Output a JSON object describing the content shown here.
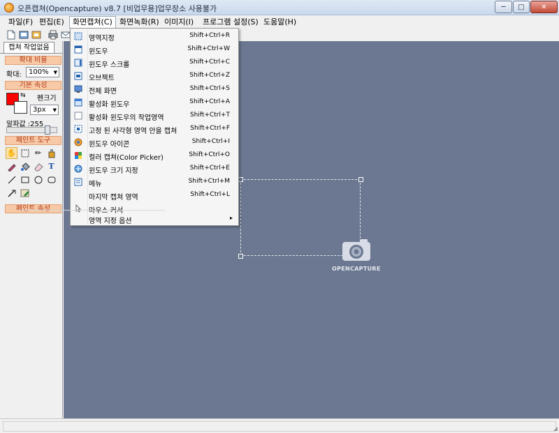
{
  "window": {
    "title": "오픈캡쳐(Opencapture) v8.7 [비업무용]업무장소 사용불가",
    "min": "─",
    "max": "□",
    "close": "✕"
  },
  "menubar": {
    "items": [
      "파일(F)",
      "편집(E)",
      "화면캡쳐(C)",
      "화면녹화(R)",
      "이미지(I)",
      "프로그램 설정(S)",
      "도움말(H)"
    ]
  },
  "left_panel": {
    "tab": "캡쳐 작업없음",
    "zoom_header": "확대 비율",
    "zoom_label": "확대:",
    "zoom_value": "100%",
    "basic_header": "기본 속성",
    "pen_label": "펜크기",
    "pen_value": "3px",
    "alpha_label": "알파값 :255",
    "paint_tools_header": "페인트 도구",
    "paint_props_header": "페인트 속성"
  },
  "canvas": {
    "brand": "OPENCAPTURE"
  },
  "capture_menu": {
    "items": [
      {
        "label": "영역지정",
        "shortcut": "Shift+Ctrl+R",
        "icon": "region-icon"
      },
      {
        "label": "윈도우",
        "shortcut": "Shift+Ctrl+W",
        "icon": "window-icon"
      },
      {
        "label": "윈도우 스크롤",
        "shortcut": "Shift+Ctrl+C",
        "icon": "scroll-icon"
      },
      {
        "label": "오브젝트",
        "shortcut": "Shift+Ctrl+Z",
        "icon": "object-icon"
      },
      {
        "label": "전체 화면",
        "shortcut": "Shift+Ctrl+S",
        "icon": "fullscreen-icon"
      },
      {
        "label": "활성화 윈도우",
        "shortcut": "Shift+Ctrl+A",
        "icon": "active-window-icon"
      },
      {
        "label": "활성화 윈도우의 작업영역",
        "shortcut": "Shift+Ctrl+T",
        "icon": "client-area-icon"
      },
      {
        "label": "고정 된 사각형 영역 안을 캡쳐",
        "shortcut": "Shift+Ctrl+F",
        "icon": "fixed-rect-icon"
      },
      {
        "label": "윈도우 아이콘",
        "shortcut": "Shift+Ctrl+I",
        "icon": "window-icon-icon"
      },
      {
        "label": "컬러 캡쳐(Color Picker)",
        "shortcut": "Shift+Ctrl+O",
        "icon": "color-picker-icon"
      },
      {
        "label": "윈도우 크기 지정",
        "shortcut": "Shift+Ctrl+E",
        "icon": "window-size-icon"
      },
      {
        "label": "메뉴",
        "shortcut": "Shift+Ctrl+M",
        "icon": "menu-icon"
      },
      {
        "label": "마지막 캡쳐 영역",
        "shortcut": "Shift+Ctrl+L",
        "icon": "last-area-icon"
      },
      {
        "label": "마우스 커서",
        "shortcut": "",
        "icon": "cursor-icon"
      }
    ],
    "options_label": "영역 지정 옵션",
    "options_arrow": "▸"
  },
  "colors": {
    "canvas": "#6c7891",
    "accent_header": "#f7c9a6",
    "fg_color": "#ff0000"
  }
}
